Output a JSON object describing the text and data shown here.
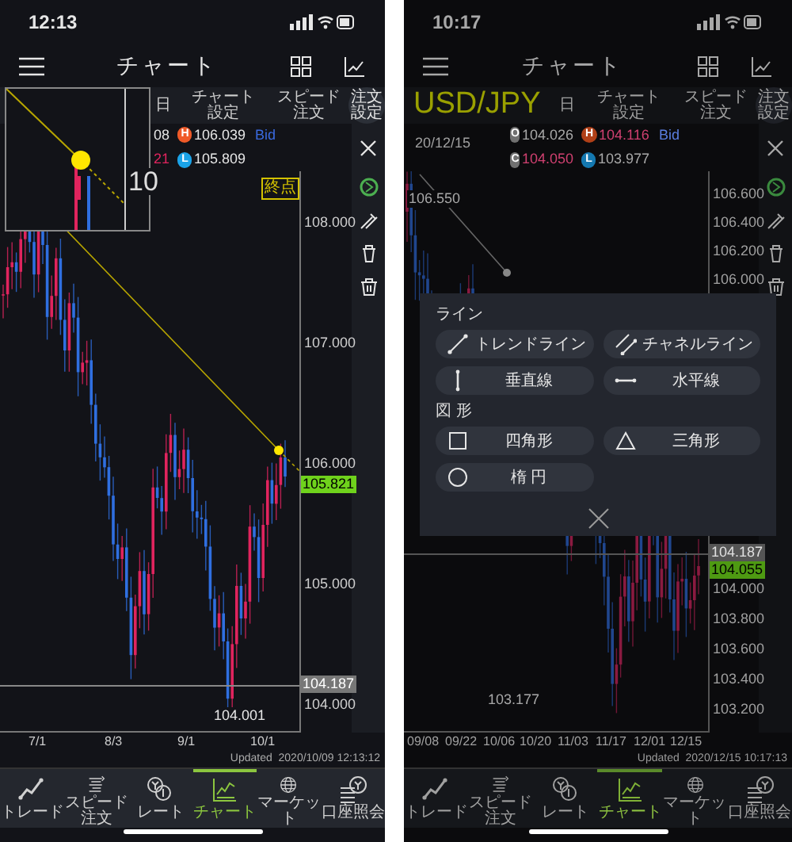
{
  "screens": [
    {
      "status_time": "12:13",
      "title": "チャート",
      "toolbar": [
        "日",
        "チャート設定",
        "スピード注文"
      ],
      "order_settings": "注文設定",
      "info": {
        "rows": [
          [
            {
              "kind": "open",
              "value": "08",
              "color": "#e6e6e6"
            },
            {
              "kind": "high",
              "badge": "H",
              "value": "106.039",
              "color": "#e6e6e6"
            }
          ],
          [
            {
              "kind": "close",
              "value": "21",
              "color": "#e0245e"
            },
            {
              "kind": "low",
              "badge": "L",
              "value": "105.809",
              "color": "#e6e6e6"
            }
          ]
        ],
        "side": "Bid"
      },
      "magnifier": {
        "text": "10"
      },
      "chart": {
        "y_labels": [
          "108.000",
          "107.000",
          "106.000",
          "105.000",
          "104.000"
        ],
        "price_tag": "105.821",
        "line_tag": "104.187",
        "low_label": "104.001",
        "end_label": "終点",
        "trend_selected": true,
        "x_labels": [
          "7/1",
          "8/3",
          "9/1",
          "10/1"
        ],
        "updated": "Updated  2020/10/09 12:13:12"
      },
      "tabs": [
        {
          "kind": "trade",
          "label": "トレード",
          "selected": false
        },
        {
          "kind": "speed",
          "label": "スピード注文",
          "selected": false
        },
        {
          "kind": "rate",
          "label": "レート",
          "selected": false
        },
        {
          "kind": "chart",
          "label": "チャート",
          "selected": true
        },
        {
          "kind": "market",
          "label": "マーケット",
          "selected": false
        },
        {
          "kind": "account",
          "label": "口座照会",
          "selected": false
        }
      ]
    },
    {
      "status_time": "10:17",
      "title": "チャート",
      "symbol": "USD/JPY",
      "toolbar": [
        "日",
        "チャート設定",
        "スピード注文"
      ],
      "order_settings": "注文設定",
      "info": {
        "date": "20/12/15",
        "rows": [
          [
            {
              "kind": "open",
              "badge": "O",
              "value": "104.026",
              "color": "#a8a8a8"
            },
            {
              "kind": "high",
              "badge": "H",
              "value": "104.116",
              "color": "#d04070"
            }
          ],
          [
            {
              "kind": "close",
              "badge": "C",
              "value": "104.050",
              "color": "#d04070"
            },
            {
              "kind": "low",
              "badge": "L",
              "value": "103.977",
              "color": "#a8a8a8"
            }
          ]
        ],
        "side": "Bid"
      },
      "chart": {
        "y_labels": [
          "106.600",
          "106.400",
          "106.200",
          "106.000",
          "104.000",
          "103.800",
          "103.600",
          "103.400",
          "103.200"
        ],
        "price_tag": "104.055",
        "line_tag": "104.187",
        "low_label": "103.177",
        "high_label": "106.550",
        "trend_selected": false,
        "x_labels": [
          "09/08",
          "09/22",
          "10/06",
          "10/20",
          "11/03",
          "11/17",
          "12/01",
          "12/15"
        ],
        "updated": "Updated  2020/12/15 10:17:13"
      },
      "tabs": [
        {
          "kind": "trade",
          "label": "トレード",
          "selected": false
        },
        {
          "kind": "speed",
          "label": "スピード注文",
          "selected": false
        },
        {
          "kind": "rate",
          "label": "レート",
          "selected": false
        },
        {
          "kind": "chart",
          "label": "チャート",
          "selected": true
        },
        {
          "kind": "market",
          "label": "マーケット",
          "selected": false
        },
        {
          "kind": "account",
          "label": "口座照会",
          "selected": false
        }
      ],
      "dialog": {
        "sections": [
          {
            "title": "ライン",
            "items": [
              {
                "kind": "trend",
                "label": "トレンドライン"
              },
              {
                "kind": "channel",
                "label": "チャネルライン"
              },
              {
                "kind": "vertical",
                "label": "垂直線"
              },
              {
                "kind": "horizontal",
                "label": "水平線"
              }
            ]
          },
          {
            "title": "図 形",
            "items": [
              {
                "kind": "rectangle",
                "label": "四角形"
              },
              {
                "kind": "triangle",
                "label": "三角形"
              },
              {
                "kind": "ellipse",
                "label": "楕 円"
              }
            ]
          }
        ]
      }
    }
  ]
}
